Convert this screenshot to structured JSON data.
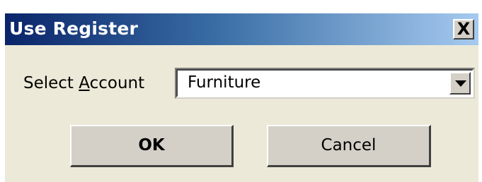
{
  "dialog": {
    "title": "Use Register",
    "close_label": "X"
  },
  "form": {
    "select_label_before": "Select ",
    "select_label_mnemonic": "A",
    "select_label_after": "ccount",
    "selected_account": "Furniture"
  },
  "buttons": {
    "ok_label": "OK",
    "cancel_label": "Cancel"
  },
  "icons": {
    "close": "close-icon",
    "dropdown": "chevron-down-icon"
  },
  "colors": {
    "titlebar_start": "#0a246a",
    "titlebar_end": "#a6caf0",
    "dialog_face": "#ece9d8",
    "button_face": "#d4d0c8"
  }
}
